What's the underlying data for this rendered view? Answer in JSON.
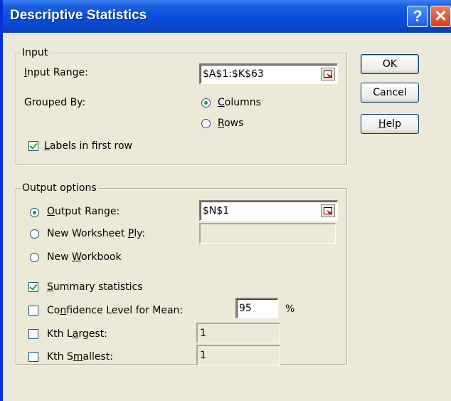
{
  "window": {
    "title": "Descriptive Statistics",
    "help_glyph": "?",
    "close_glyph": "✕"
  },
  "input_group": {
    "title": "Input",
    "input_range_label_u": "I",
    "input_range_label_rest": "nput Range:",
    "input_range_value": "$A$1:$K$63",
    "grouped_by_label": "Grouped By:",
    "columns_label_u": "C",
    "columns_label_rest": "olumns",
    "rows_label_u": "R",
    "rows_label_rest": "ows",
    "grouped_by_selected": "Columns",
    "labels_label_u": "L",
    "labels_label_rest": "abels in first row",
    "labels_checked": true
  },
  "output_group": {
    "title": "Output options",
    "output_range_label_u": "O",
    "output_range_label_rest": "utput Range:",
    "output_range_value": "$N$1",
    "new_ws_label_pre": "New Worksheet ",
    "new_ws_label_u": "P",
    "new_ws_label_post": "ly:",
    "new_ws_value": "",
    "new_wb_label_pre": "New ",
    "new_wb_label_u": "W",
    "new_wb_label_post": "orkbook",
    "output_selected": "Output Range",
    "summary_label_u": "S",
    "summary_label_rest": "ummary statistics",
    "summary_checked": true,
    "conf_label_pre": "Co",
    "conf_label_u": "n",
    "conf_label_post": "fidence Level for Mean:",
    "conf_checked": false,
    "conf_value": "95",
    "conf_unit": "%",
    "kth_largest_pre": "Kth L",
    "kth_largest_u": "a",
    "kth_largest_post": "rgest:",
    "kth_largest_checked": false,
    "kth_largest_value": "1",
    "kth_smallest_pre": "Kth S",
    "kth_smallest_u": "m",
    "kth_smallest_post": "allest:",
    "kth_smallest_checked": false,
    "kth_smallest_value": "1"
  },
  "buttons": {
    "ok": "OK",
    "cancel": "Cancel",
    "help_u": "H",
    "help_rest": "elp"
  },
  "icons": [
    "help-icon",
    "close-icon",
    "collapse-dialog-icon"
  ]
}
